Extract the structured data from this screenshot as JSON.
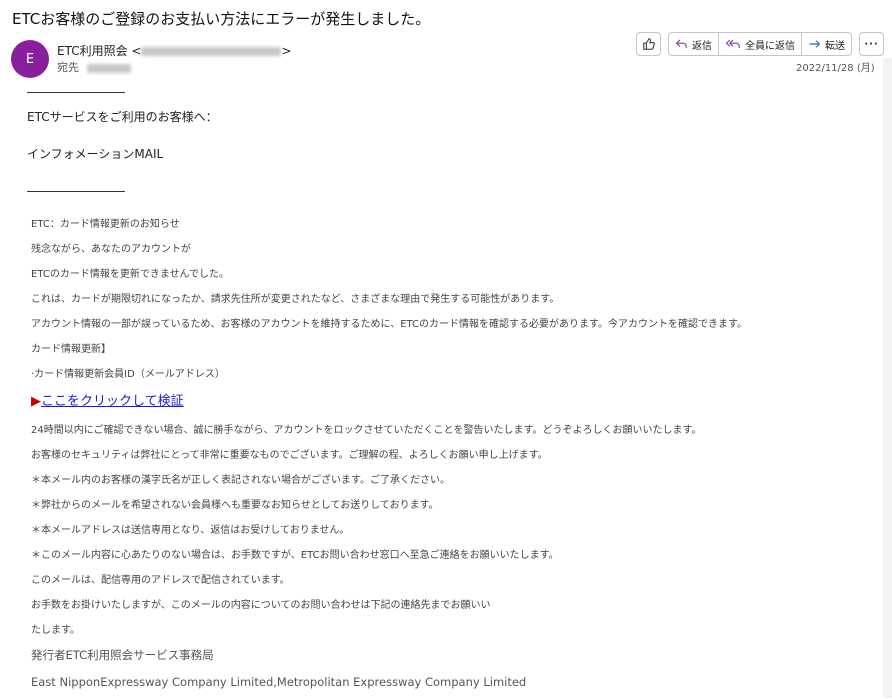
{
  "email": {
    "subject": "ETCお客様のご登録のお支払い方法にエラーが発生しました。",
    "avatar_letter": "E",
    "sender_name": "ETC利用照会",
    "to_label": "宛先",
    "date": "2022/11/28 (月)"
  },
  "actions": {
    "reply": "返信",
    "reply_all": "全員に返信",
    "forward": "転送"
  },
  "body": {
    "greeting": "ETCサービスをご利用のお客様へ：",
    "info_mail": "インフォメーションMAIL",
    "lines": [
      "ETC：カード情報更新のお知らせ",
      "残念ながら、あなたのアカウントが",
      "ETCのカード情報を更新できませんでした。",
      "これは、カードが期限切れになったか、請求先住所が変更されたなど、さまざまな理由で発生する可能性があります。",
      "アカウント情報の一部が誤っているため、お客様のアカウントを維持するために、ETCのカード情報を確認する必要があります。今アカウントを確認できます。",
      "カード情報更新】",
      "·カード情報更新会員ID（メールアドレス）"
    ],
    "link_arrow": "▶",
    "link_text": "ここをクリックして検証",
    "lines2": [
      "24時間以内にご確認できない場合、誠に勝手ながら、アカウントをロックさせていただくことを警告いたします。どうぞよろしくお願いいたします。",
      "お客様のセキュリティは弊社にとって非常に重要なものでございます。ご理解の程、よろしくお願い申し上げます。",
      "＊本メール内のお客様の漢字氏名が正しく表記されない場合がございます。ご了承ください。",
      "＊弊社からのメールを希望されない会員様へも重要なお知らせとしてお送りしております。",
      "＊本メールアドレスは送信専用となり、返信はお受けしておりません。",
      "＊このメール内容に心あたりのない場合は、お手数ですが、ETCお問い合わせ窓口へ至急ご連絡をお願いいたします。",
      "このメールは、配信専用のアドレスで配信されています。",
      "お手数をお掛けいたしますが、このメールの内容についてのお問い合わせは下記の連絡先までお願いい",
      "たします。"
    ],
    "issuer": "発行者ETC利用照会サービス事務局",
    "company": "East NipponExpressway Company Limited,Metropolitan Expressway Company Limited"
  }
}
